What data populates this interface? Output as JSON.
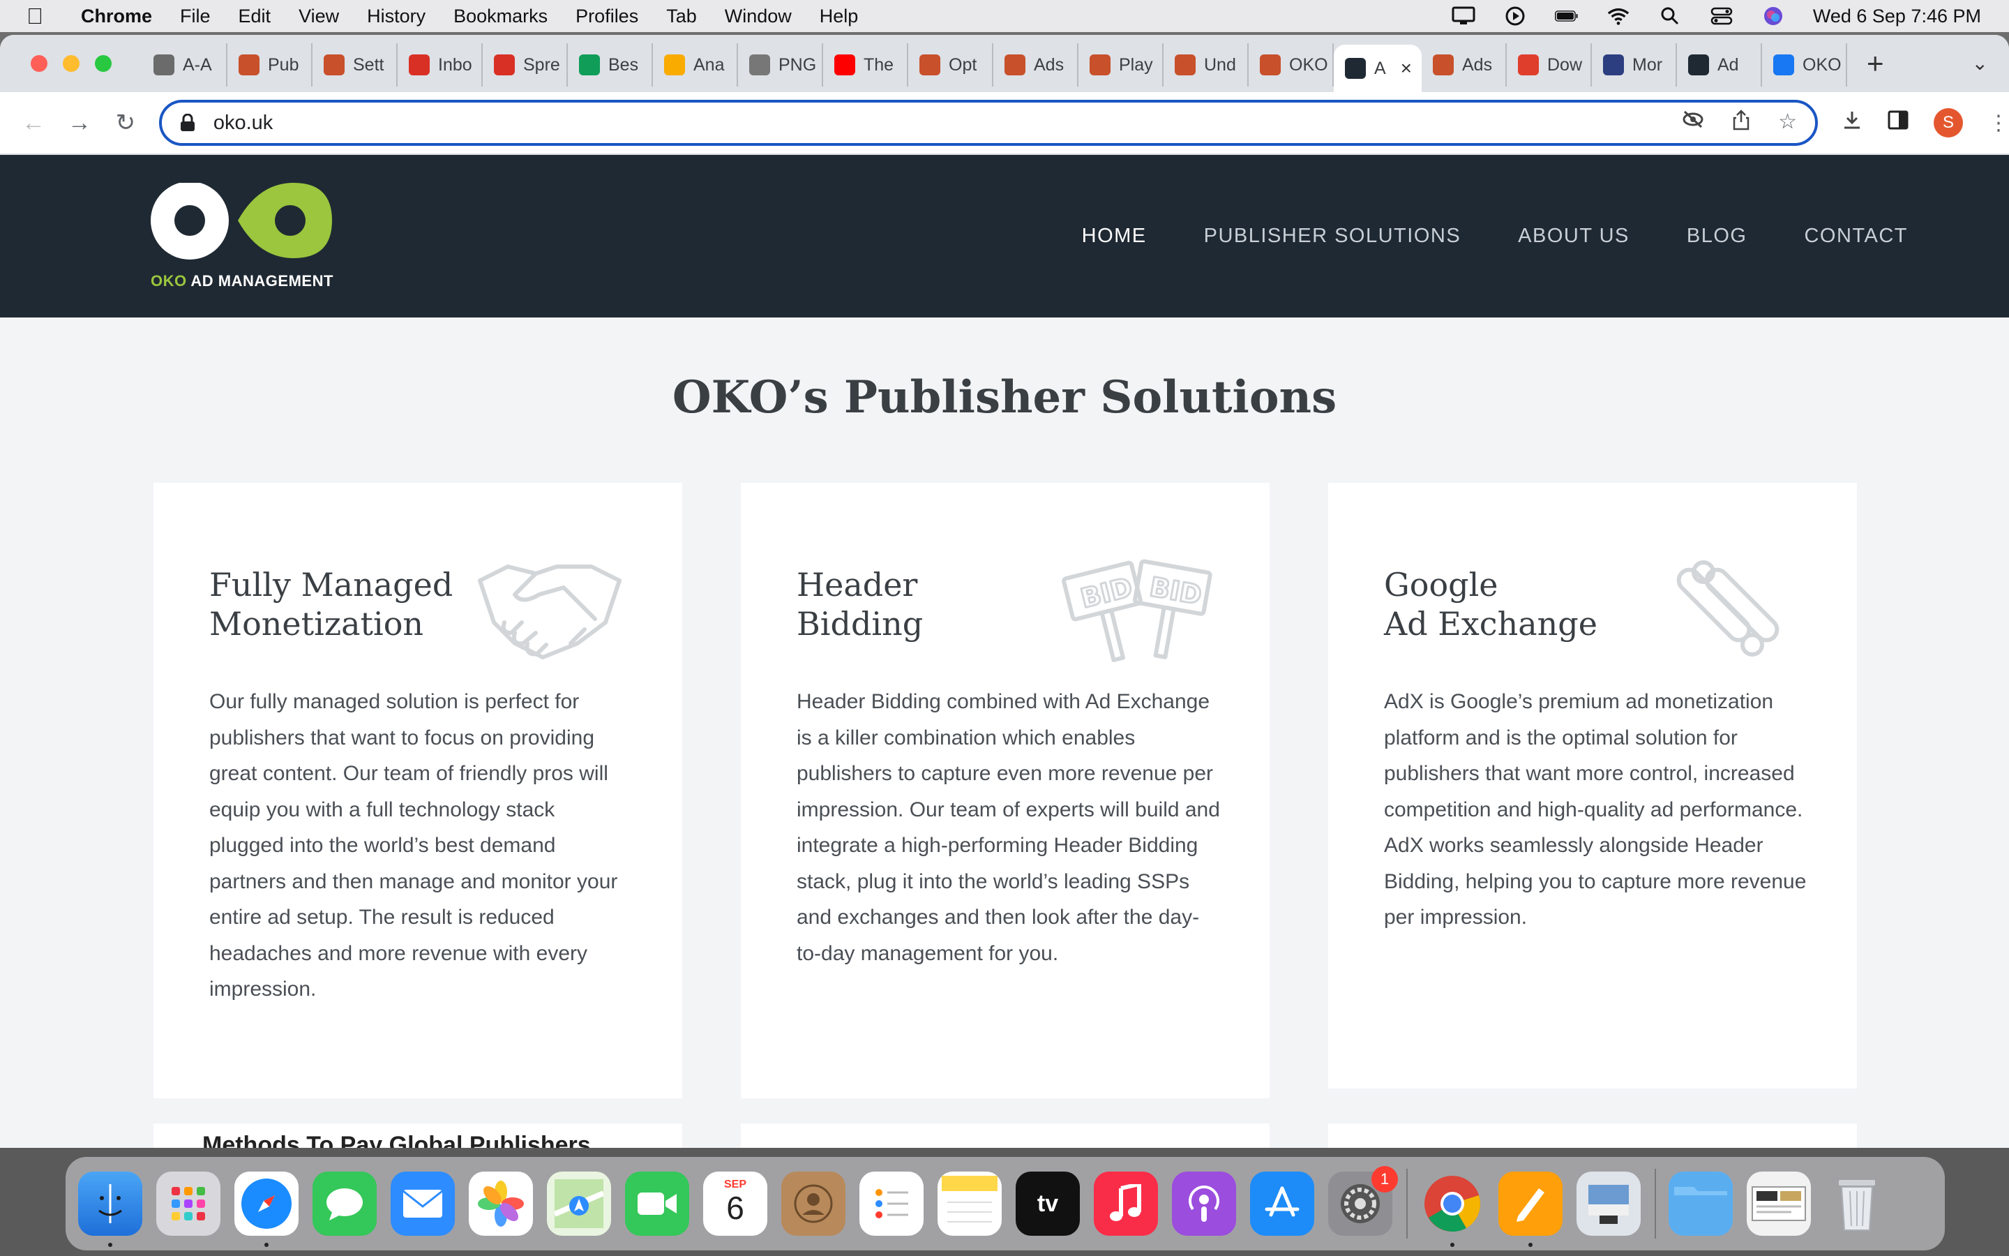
{
  "menubar": {
    "app_name": "Chrome",
    "items": [
      "File",
      "Edit",
      "View",
      "History",
      "Bookmarks",
      "Profiles",
      "Tab",
      "Window",
      "Help"
    ],
    "clock": "Wed 6 Sep  7:46 PM"
  },
  "tabs": [
    {
      "label": "A-A",
      "favicon": "openai-icon",
      "color": "#6b6b6b"
    },
    {
      "label": "Pub",
      "favicon": "flag-icon",
      "color": "#c8502a"
    },
    {
      "label": "Sett",
      "favicon": "flag-icon",
      "color": "#c8502a"
    },
    {
      "label": "Inbo",
      "favicon": "gmail-icon",
      "color": "#d93025"
    },
    {
      "label": "Spre",
      "favicon": "gmail-icon",
      "color": "#d93025"
    },
    {
      "label": "Bes",
      "favicon": "sheets-icon",
      "color": "#0f9d58"
    },
    {
      "label": "Ana",
      "favicon": "analytics-icon",
      "color": "#f9ab00"
    },
    {
      "label": "PNG",
      "favicon": "cloud-icon",
      "color": "#777777"
    },
    {
      "label": "The",
      "favicon": "youtube-icon",
      "color": "#ff0000"
    },
    {
      "label": "Opt",
      "favicon": "flag-icon",
      "color": "#c8502a"
    },
    {
      "label": "Ads",
      "favicon": "flag-icon",
      "color": "#c8502a"
    },
    {
      "label": "Play",
      "favicon": "flag-icon",
      "color": "#c8502a"
    },
    {
      "label": "Und",
      "favicon": "flag-icon",
      "color": "#c8502a"
    },
    {
      "label": "OKO",
      "favicon": "flag-icon",
      "color": "#c8502a"
    },
    {
      "label": "A",
      "favicon": "oko-icon",
      "color": "#1f2933",
      "active": true
    },
    {
      "label": "Ads",
      "favicon": "flag-icon",
      "color": "#c8502a"
    },
    {
      "label": "Dow",
      "favicon": "recycle-icon",
      "color": "#e03e2d"
    },
    {
      "label": "Mor",
      "favicon": "shield-icon",
      "color": "#2c3e80"
    },
    {
      "label": "Ad",
      "favicon": "oko-icon",
      "color": "#1f2933"
    },
    {
      "label": "OKO",
      "favicon": "facebook-icon",
      "color": "#1877f2"
    }
  ],
  "address_bar": {
    "url": "oko.uk"
  },
  "profile_initial": "S",
  "site": {
    "logo_text_green": "OKO",
    "logo_text_white": " AD MANAGEMENT",
    "nav": [
      {
        "label": "HOME",
        "active": true
      },
      {
        "label": "PUBLISHER SOLUTIONS"
      },
      {
        "label": "ABOUT US"
      },
      {
        "label": "BLOG"
      },
      {
        "label": "CONTACT"
      }
    ],
    "section_title": "OKO’s Publisher Solutions",
    "cards": [
      {
        "title_line1": "Fully Managed",
        "title_line2": "Monetization",
        "icon": "handshake-icon",
        "body": "Our fully managed solution is perfect for publishers that want to focus on providing great content. Our team of friendly pros will equip you with a full technology stack plugged into the world’s best demand partners and then manage and monitor your entire ad setup. The result is reduced headaches and more revenue with every impression."
      },
      {
        "title_line1": "Header",
        "title_line2": "Bidding",
        "icon": "bid-signs-icon",
        "icon_text": "BID",
        "body": "Header Bidding combined with Ad Exchange is a killer combination which enables publishers to capture even more revenue per impression. Our team of experts will build and integrate a high-performing Header Bidding stack, plug it into the world’s leading SSPs and exchanges and then look after the day-to-day management for you."
      },
      {
        "title_line1": "Google",
        "title_line2": "Ad Exchange",
        "icon": "adx-icon",
        "body": "AdX is Google’s premium ad monetization platform and is the optimal solution for publishers that want more control, increased competition and high-quality ad performance. AdX works seamlessly alongside Header Bidding, helping you to capture more revenue per impression."
      }
    ],
    "peek_text": "Methods To Pay Global Publishers"
  },
  "dock": {
    "calendar_month": "SEP",
    "calendar_day": "6",
    "settings_badge": "1",
    "tv_label": "tv"
  }
}
